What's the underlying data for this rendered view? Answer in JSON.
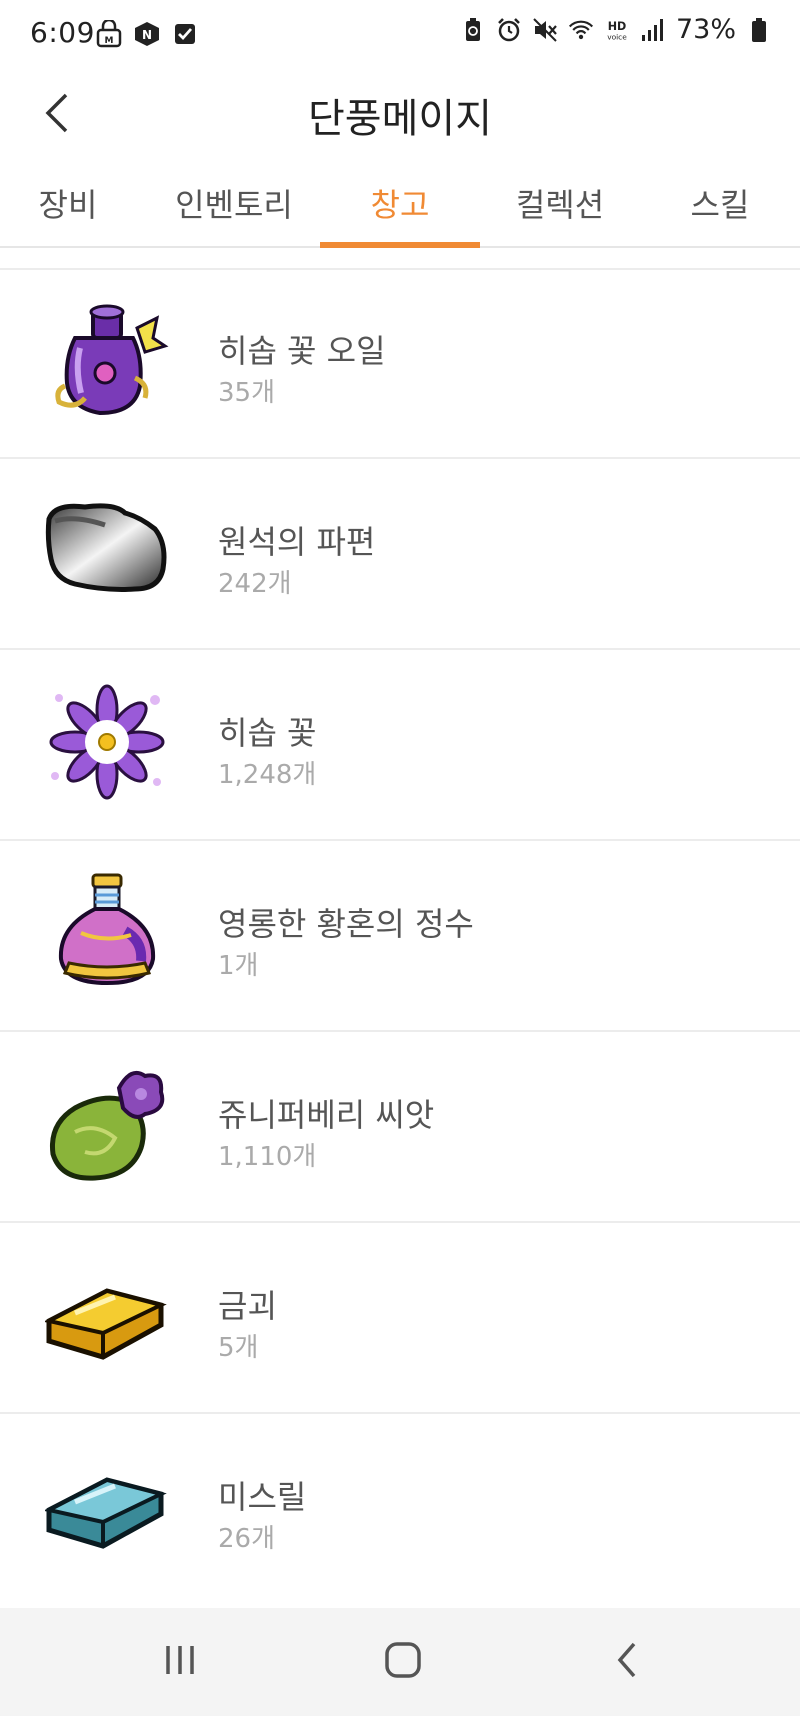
{
  "status_bar": {
    "time": "6:09",
    "battery": "73%",
    "icons": [
      "lock-m-icon",
      "naver-icon",
      "checkbox-icon",
      "battery-saver-icon",
      "alarm-icon",
      "mute-icon",
      "wifi-icon",
      "hd-voice-icon",
      "signal-icon",
      "battery-icon"
    ]
  },
  "header": {
    "title": "단풍메이지",
    "back_icon": "chevron-left-icon"
  },
  "tabs": [
    {
      "label": "장비",
      "active": false
    },
    {
      "label": "인벤토리",
      "active": false
    },
    {
      "label": "창고",
      "active": true
    },
    {
      "label": "컬렉션",
      "active": false
    },
    {
      "label": "스킬",
      "active": false
    }
  ],
  "accent_color": "#f08a34",
  "items": [
    {
      "name": "히솝 꽃 오일",
      "count": "35개",
      "icon": "purple-oil-bottle-icon"
    },
    {
      "name": "원석의 파편",
      "count": "242개",
      "icon": "ore-fragment-icon"
    },
    {
      "name": "히솝 꽃",
      "count": "1,248개",
      "icon": "purple-flower-icon"
    },
    {
      "name": "영롱한 황혼의 정수",
      "count": "1개",
      "icon": "twilight-essence-flask-icon"
    },
    {
      "name": "쥬니퍼베리 씨앗",
      "count": "1,110개",
      "icon": "seed-pouch-icon"
    },
    {
      "name": "금괴",
      "count": "5개",
      "icon": "gold-bar-icon"
    },
    {
      "name": "미스릴",
      "count": "26개",
      "icon": "mithril-bar-icon"
    }
  ],
  "nav_bar": {
    "recents_icon": "recents-icon",
    "home_icon": "home-icon",
    "back_icon": "back-icon"
  }
}
